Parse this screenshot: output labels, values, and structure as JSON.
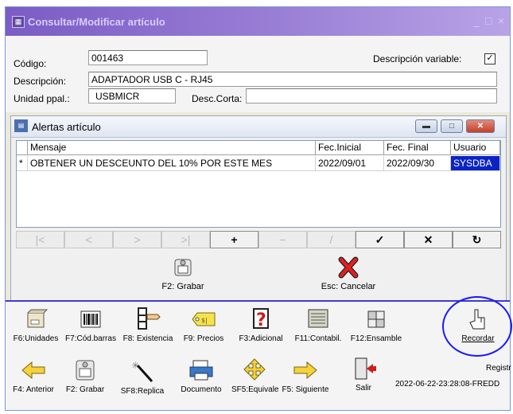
{
  "window": {
    "title": "Consultar/Modificar artículo",
    "controls": [
      "_",
      "□",
      "×"
    ]
  },
  "form": {
    "codigo_label": "Código:",
    "codigo_value": "001463",
    "descripcion_variable_label": "Descripción variable:",
    "descripcion_variable_checked": true,
    "descripcion_label": "Descripción:",
    "descripcion_value": "ADAPTADOR USB C - RJ45",
    "unidad_label": "Unidad ppal.:",
    "unidad_value": "USBMICR",
    "desc_corta_label": "Desc.Corta:",
    "desc_corta_value": ""
  },
  "alerts": {
    "title": "Alertas artículo",
    "columns": [
      "Mensaje",
      "Fec.Inicial",
      "Fec. Final",
      "Usuario"
    ],
    "rows": [
      {
        "marker": "*",
        "mensaje": "OBTENER UN DESCEUNTO DEL 10% POR ESTE MES",
        "fec_inicial": "2022/09/01",
        "fec_final": "2022/09/30",
        "usuario": "SYSDBA"
      }
    ],
    "nav_buttons": [
      "|<",
      "<",
      ">",
      ">|",
      "+",
      "−",
      "/",
      "✓",
      "✕",
      "↻"
    ],
    "save_label": "F2: Grabar",
    "cancel_label": "Esc: Cancelar"
  },
  "toolbar1": [
    {
      "label": "F6:Unidades",
      "icon": "box-icon"
    },
    {
      "label": "F7:Cód.barras",
      "icon": "barcode-icon"
    },
    {
      "label": "F8: Existencia",
      "icon": "stock-hand-icon"
    },
    {
      "label": "F9: Precios",
      "icon": "price-tag-icon"
    },
    {
      "label": "F3:Adicional",
      "icon": "question-icon"
    },
    {
      "label": "F11:Contabil.",
      "icon": "ledger-icon"
    },
    {
      "label": "F12:Ensamble",
      "icon": "assembly-icon"
    },
    {
      "label": "Recordar",
      "icon": "pointing-hand-icon"
    }
  ],
  "toolbar2": [
    {
      "label": "F4: Anterior",
      "icon": "arrow-left-icon"
    },
    {
      "label": "F2: Grabar",
      "icon": "save-icon"
    },
    {
      "label": "SF8:Replica",
      "icon": "magic-wand-icon"
    },
    {
      "label": "Documento",
      "icon": "printer-icon"
    },
    {
      "label": "SF5:Equivale",
      "icon": "equivalence-icon"
    },
    {
      "label": "F5: Siguiente",
      "icon": "arrow-right-icon"
    },
    {
      "label": "Salir",
      "icon": "exit-door-icon"
    }
  ],
  "registry": {
    "label": "Registr",
    "value": "2022-06-22-23:28:08-FREDD"
  }
}
